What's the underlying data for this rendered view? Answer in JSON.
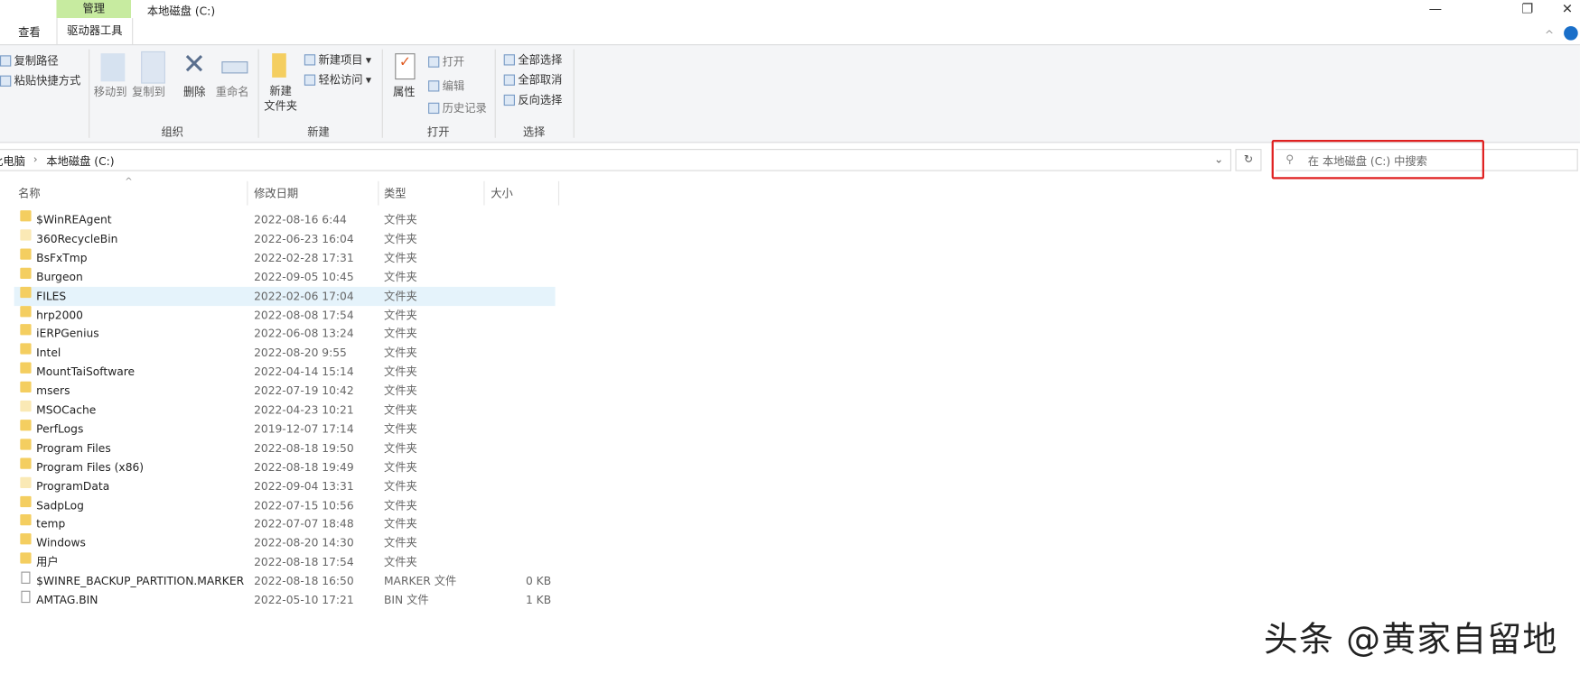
{
  "window": {
    "title": "本地磁盘 (C:)",
    "context_tab_group": "管理",
    "minimize": "—",
    "restore": "❐",
    "close": "✕",
    "collapse_ribbon": "^"
  },
  "tabs": [
    {
      "label": "查看"
    },
    {
      "label": "驱动器工具"
    }
  ],
  "ribbon": {
    "clipboard": {
      "copy_path": "复制路径",
      "paste_shortcut": "粘贴快捷方式"
    },
    "organize": {
      "label": "组织",
      "move_to": "移动到",
      "copy_to": "复制到",
      "delete": "删除",
      "rename": "重命名"
    },
    "new": {
      "label": "新建",
      "new_folder_line1": "新建",
      "new_folder_line2": "文件夹",
      "new_item": "新建项目",
      "easy_access": "轻松访问"
    },
    "open": {
      "label": "打开",
      "properties": "属性",
      "open": "打开",
      "edit": "编辑",
      "history": "历史记录"
    },
    "select": {
      "label": "选择",
      "select_all": "全部选择",
      "select_none": "全部取消",
      "invert": "反向选择"
    }
  },
  "address": {
    "crumbs": [
      "此电脑",
      "本地磁盘 (C:)"
    ],
    "separator": "›",
    "search_placeholder": "在 本地磁盘 (C:) 中搜索"
  },
  "columns": {
    "name": "名称",
    "date": "修改日期",
    "type": "类型",
    "size": "大小"
  },
  "files": [
    {
      "name": "$WinREAgent",
      "date": "2022-08-16 6:44",
      "type": "文件夹",
      "size": "",
      "kind": "folder"
    },
    {
      "name": "360RecycleBin",
      "date": "2022-06-23 16:04",
      "type": "文件夹",
      "size": "",
      "kind": "folder-light"
    },
    {
      "name": "BsFxTmp",
      "date": "2022-02-28 17:31",
      "type": "文件夹",
      "size": "",
      "kind": "folder"
    },
    {
      "name": "Burgeon",
      "date": "2022-09-05 10:45",
      "type": "文件夹",
      "size": "",
      "kind": "folder"
    },
    {
      "name": "FILES",
      "date": "2022-02-06 17:04",
      "type": "文件夹",
      "size": "",
      "kind": "folder",
      "selected": true
    },
    {
      "name": "hrp2000",
      "date": "2022-08-08 17:54",
      "type": "文件夹",
      "size": "",
      "kind": "folder"
    },
    {
      "name": "iERPGenius",
      "date": "2022-06-08 13:24",
      "type": "文件夹",
      "size": "",
      "kind": "folder"
    },
    {
      "name": "Intel",
      "date": "2022-08-20 9:55",
      "type": "文件夹",
      "size": "",
      "kind": "folder"
    },
    {
      "name": "MountTaiSoftware",
      "date": "2022-04-14 15:14",
      "type": "文件夹",
      "size": "",
      "kind": "folder"
    },
    {
      "name": "msers",
      "date": "2022-07-19 10:42",
      "type": "文件夹",
      "size": "",
      "kind": "folder"
    },
    {
      "name": "MSOCache",
      "date": "2022-04-23 10:21",
      "type": "文件夹",
      "size": "",
      "kind": "folder-light"
    },
    {
      "name": "PerfLogs",
      "date": "2019-12-07 17:14",
      "type": "文件夹",
      "size": "",
      "kind": "folder"
    },
    {
      "name": "Program Files",
      "date": "2022-08-18 19:50",
      "type": "文件夹",
      "size": "",
      "kind": "folder"
    },
    {
      "name": "Program Files (x86)",
      "date": "2022-08-18 19:49",
      "type": "文件夹",
      "size": "",
      "kind": "folder"
    },
    {
      "name": "ProgramData",
      "date": "2022-09-04 13:31",
      "type": "文件夹",
      "size": "",
      "kind": "folder-light"
    },
    {
      "name": "SadpLog",
      "date": "2022-07-15 10:56",
      "type": "文件夹",
      "size": "",
      "kind": "folder"
    },
    {
      "name": "temp",
      "date": "2022-07-07 18:48",
      "type": "文件夹",
      "size": "",
      "kind": "folder"
    },
    {
      "name": "Windows",
      "date": "2022-08-20 14:30",
      "type": "文件夹",
      "size": "",
      "kind": "folder"
    },
    {
      "name": "用户",
      "date": "2022-08-18 17:54",
      "type": "文件夹",
      "size": "",
      "kind": "folder"
    },
    {
      "name": "$WINRE_BACKUP_PARTITION.MARKER",
      "date": "2022-08-18 16:50",
      "type": "MARKER 文件",
      "size": "0 KB",
      "kind": "file"
    },
    {
      "name": "AMTAG.BIN",
      "date": "2022-05-10 17:21",
      "type": "BIN 文件",
      "size": "1 KB",
      "kind": "file"
    }
  ],
  "watermark": "头条 @黄家自留地",
  "colors": {
    "context_tab": "#c7eba0",
    "highlight": "#e02020",
    "selection": "#e5f3fb",
    "folder": "#f4ce60"
  }
}
